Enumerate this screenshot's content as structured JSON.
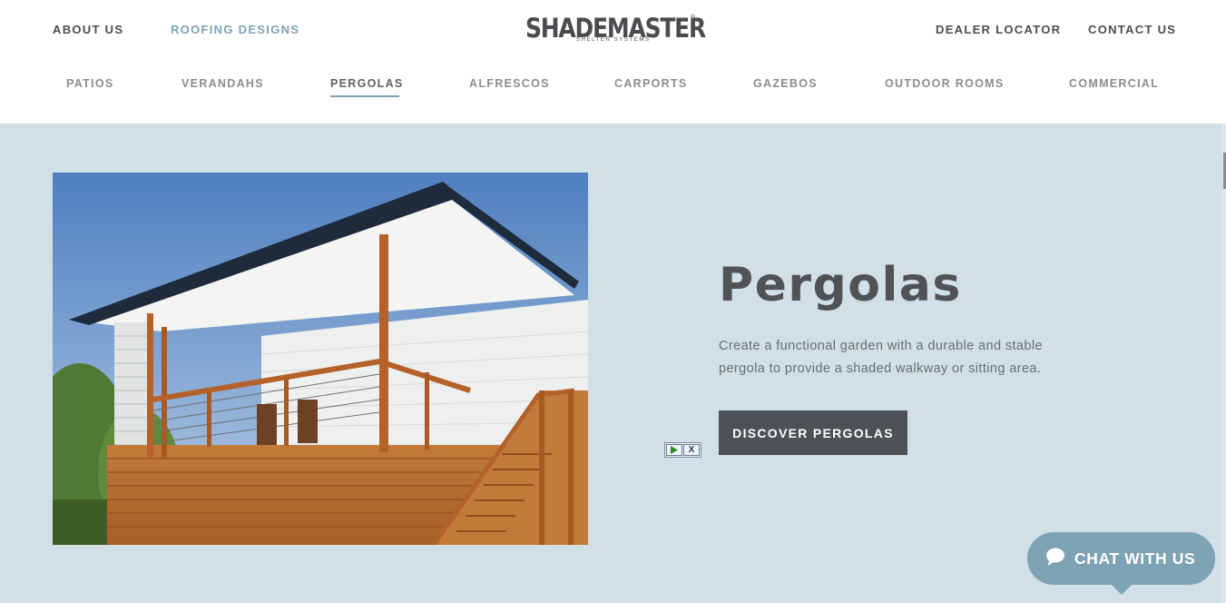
{
  "header": {
    "left_links": [
      "ABOUT US",
      "ROOFING DESIGNS"
    ],
    "right_links": [
      "DEALER LOCATOR",
      "CONTACT US"
    ],
    "logo": {
      "text": "SHADEMASTER",
      "subtext": "SHELTER SYSTEMS",
      "reg": "®"
    }
  },
  "nav": {
    "items": [
      "PATIOS",
      "VERANDAHS",
      "PERGOLAS",
      "ALFRESCOS",
      "CARPORTS",
      "GAZEBOS",
      "OUTDOOR ROOMS",
      "COMMERCIAL"
    ],
    "active": "PERGOLAS"
  },
  "hero": {
    "title": "Pergolas",
    "description": "Create a functional garden with a durable and stable pergola to provide a shaded walkway or sitting area.",
    "cta_label": "DISCOVER PERGOLAS",
    "image_icon": "pergola-photo"
  },
  "ad": {
    "play_icon": "play-icon",
    "close_label": "X"
  },
  "chat": {
    "label": "CHAT WITH US",
    "icon": "speech-bubble-icon"
  },
  "colors": {
    "accent": "#7ea3b5",
    "background": "#d1dfe6",
    "button": "#4d5054",
    "text_dark": "#4a4c4f"
  }
}
